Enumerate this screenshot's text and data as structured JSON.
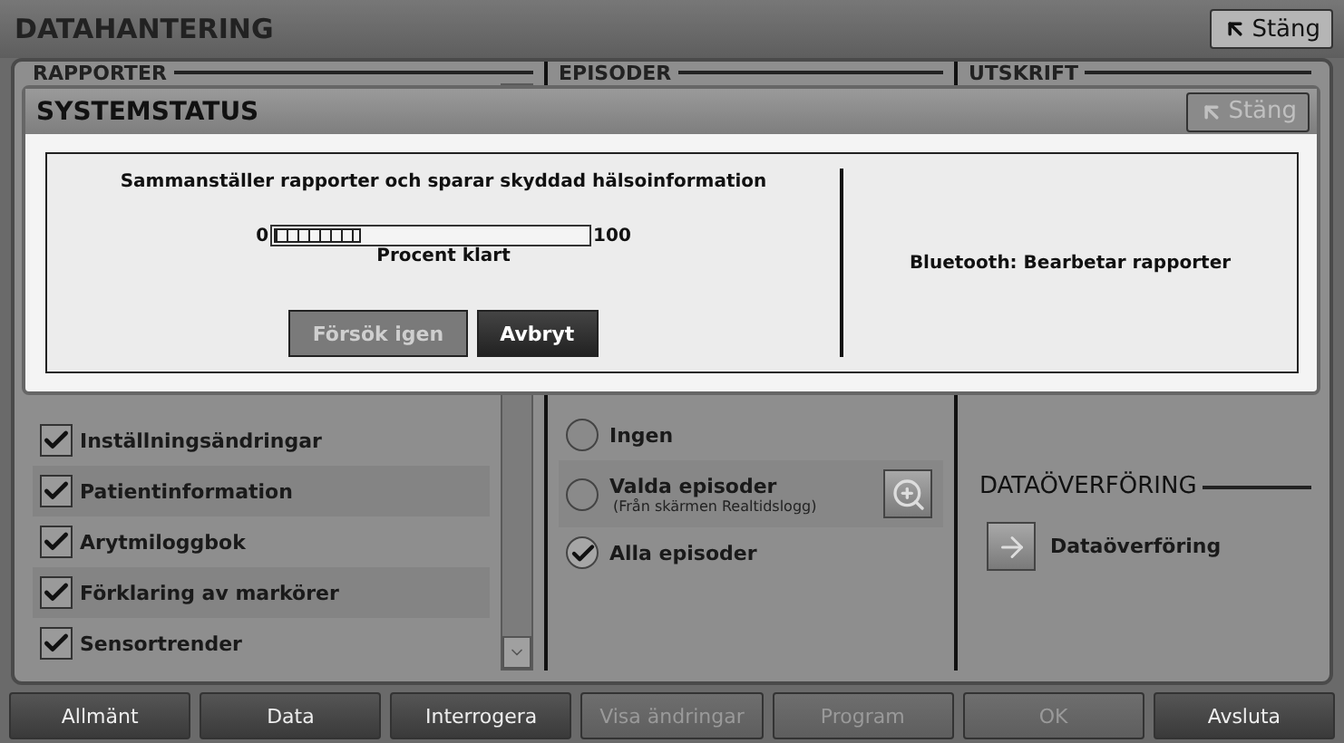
{
  "window": {
    "title": "DATAHANTERING",
    "close": {
      "label": "Stäng",
      "disabled": false
    }
  },
  "sections": [
    {
      "heading": "RAPPORTER"
    },
    {
      "heading": "EPISODER"
    },
    {
      "heading": "UTSKRIFT"
    }
  ],
  "reports": [
    {
      "label": "Inställningsändringar",
      "checked": true
    },
    {
      "label": "Patientinformation",
      "checked": true
    },
    {
      "label": "Arytmiloggbok",
      "checked": true
    },
    {
      "label": "Förklaring av markörer",
      "checked": true
    },
    {
      "label": "Sensortrender",
      "checked": true
    }
  ],
  "episodes": [
    {
      "label": "Ingen",
      "selected": false,
      "kind": "plain"
    },
    {
      "label": "Valda episoder",
      "note": "(Från skärmen Realtidslogg)",
      "selected": false,
      "kind": "browse"
    },
    {
      "label": "Alla episoder",
      "selected": true,
      "kind": "plain"
    }
  ],
  "transfer": {
    "heading": "DATAÖVERFÖRING",
    "button": "Dataöverföring"
  },
  "dialog": {
    "title": "SYSTEMSTATUS",
    "close": {
      "label": "Stäng",
      "disabled": true
    },
    "message": "Sammanställer rapporter och sparar skyddad hälsoinformation",
    "progress": {
      "min": "0",
      "max": "100",
      "level": 0.28,
      "caption": "Procent klart"
    },
    "buttons": [
      {
        "label": "Försök igen",
        "disabled": true
      },
      {
        "label": "Avbryt",
        "disabled": false
      }
    ],
    "status": "Bluetooth: Bearbetar rapporter"
  },
  "nav": [
    {
      "label": "Allmänt",
      "disabled": false
    },
    {
      "label": "Data",
      "disabled": false
    },
    {
      "label": "Interrogera",
      "disabled": false
    },
    {
      "label": "Visa ändringar",
      "disabled": true
    },
    {
      "label": "Program",
      "disabled": true
    },
    {
      "label": "OK",
      "disabled": true
    },
    {
      "label": "Avsluta",
      "disabled": false
    }
  ]
}
